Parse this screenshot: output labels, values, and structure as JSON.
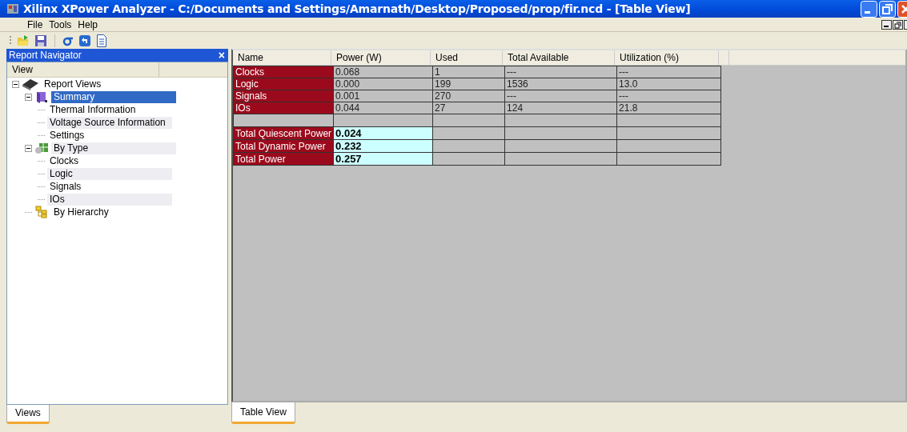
{
  "window": {
    "title": "Xilinx XPower Analyzer - C:/Documents and Settings/Amarnath/Desktop/Proposed/prop/fir.ncd - [Table View]"
  },
  "menu": [
    "File",
    "Tools",
    "Help"
  ],
  "navigator": {
    "title": "Report Navigator",
    "close": "×",
    "column": "View",
    "tree": [
      {
        "label": "Report Views",
        "kind": "chip",
        "expanded": true,
        "selected": false,
        "children": [
          {
            "label": "Summary",
            "kind": "book",
            "expanded": true,
            "selected": true,
            "children": [
              {
                "label": "Thermal Information",
                "selected": false
              },
              {
                "label": "Voltage Source Information",
                "selected": false
              },
              {
                "label": "Settings",
                "selected": false
              }
            ]
          },
          {
            "label": "By Type",
            "kind": "type",
            "expanded": true,
            "selected": false,
            "children": [
              {
                "label": "Clocks",
                "selected": false
              },
              {
                "label": "Logic",
                "selected": false
              },
              {
                "label": "Signals",
                "selected": false
              },
              {
                "label": "IOs",
                "selected": false
              }
            ]
          },
          {
            "label": "By Hierarchy",
            "kind": "hierarchy",
            "selected": false
          }
        ]
      }
    ]
  },
  "table": {
    "columns": [
      "Name",
      "Power (W)",
      "Used",
      "Total Available",
      "Utilization (%)"
    ],
    "rows": [
      {
        "kind": "item",
        "cells": [
          "Clocks",
          "0.068",
          "1",
          "---",
          "---"
        ]
      },
      {
        "kind": "item",
        "cells": [
          "Logic",
          "0.000",
          "199",
          "1536",
          "13.0"
        ]
      },
      {
        "kind": "item",
        "cells": [
          "Signals",
          "0.001",
          "270",
          "---",
          "---"
        ]
      },
      {
        "kind": "item",
        "cells": [
          "IOs",
          "0.044",
          "27",
          "124",
          "21.8"
        ]
      },
      {
        "kind": "spacer"
      },
      {
        "kind": "total",
        "cells": [
          "Total Quiescent Power",
          "0.024"
        ]
      },
      {
        "kind": "total",
        "cells": [
          "Total Dynamic Power",
          "0.232"
        ]
      },
      {
        "kind": "total",
        "cells": [
          "Total Power",
          "0.257"
        ]
      }
    ]
  },
  "left_tabs": [
    {
      "label": "Views",
      "selected": true
    }
  ],
  "right_tabs": [
    {
      "label": "Table View",
      "selected": true
    }
  ]
}
